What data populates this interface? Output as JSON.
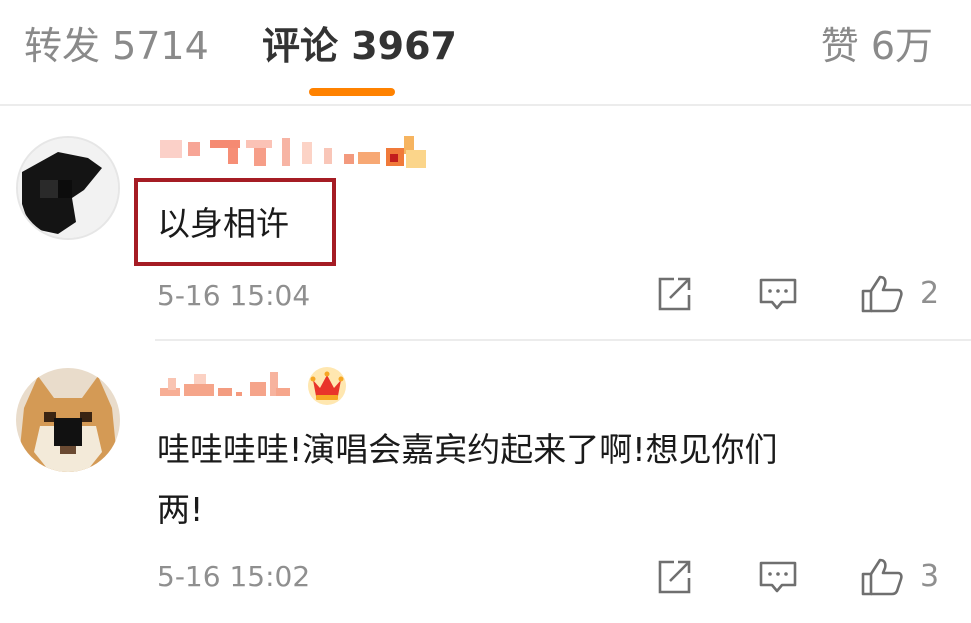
{
  "tabs": {
    "repost": "转发 5714",
    "comments": "评论 3967",
    "likes": "赞 6万"
  },
  "accent_color": "#ff8200",
  "highlight_color": "#a51c24",
  "comments": [
    {
      "text": "以身相许",
      "time": "5-16 15:04",
      "like_count": "2",
      "highlighted": true
    },
    {
      "text_line1": "哇哇哇哇!演唱会嘉宾约起来了啊!想见你们",
      "text_line2": "两!",
      "time": "5-16 15:02",
      "like_count": "3",
      "badge": "crown-icon"
    }
  ],
  "action_icons": [
    "share-icon",
    "reply-icon",
    "like-icon"
  ]
}
